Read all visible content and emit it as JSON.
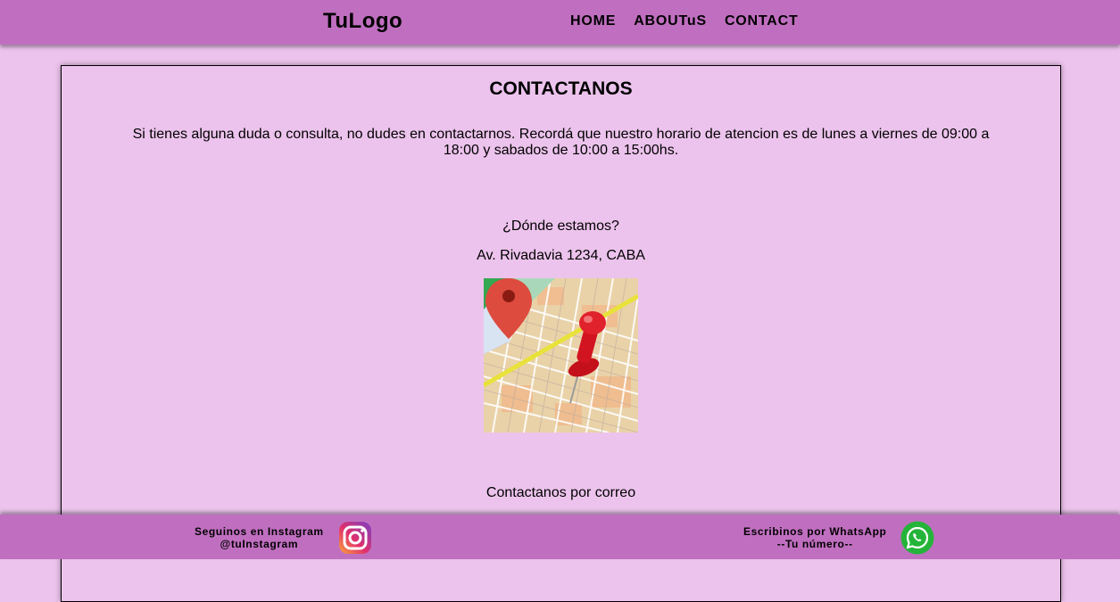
{
  "header": {
    "logo": "TuLogo",
    "nav": [
      "HOME",
      "ABOUTuS",
      "CONTACT"
    ]
  },
  "contact": {
    "title": "CONTACTANOS",
    "intro": "Si tienes alguna duda o consulta, no dudes en contactarnos. Recordá que nuestro horario de atencion es de lunes a viernes de 09:00 a 18:00 y sabados de 10:00 a 15:00hs.",
    "where_label": "¿Dónde estamos?",
    "address": "Av. Rivadavia 1234, CABA",
    "email_label": "Contactanos por correo"
  },
  "footer": {
    "instagram_line1": "Seguinos en Instagram",
    "instagram_line2": "@tuInstagram",
    "whatsapp_line1": "Escribinos por WhatsApp",
    "whatsapp_line2": "--Tu número--"
  },
  "colors": {
    "bar": "#c06fc0",
    "background": "#ecc3ec"
  },
  "icons": [
    "map-pin-icon",
    "instagram-icon",
    "whatsapp-icon"
  ]
}
